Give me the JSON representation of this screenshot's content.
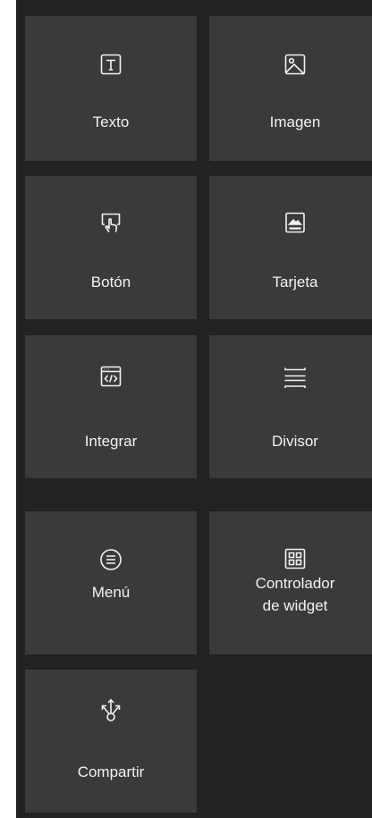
{
  "widgets": [
    {
      "label": "Texto",
      "icon": "text-icon"
    },
    {
      "label": "Imagen",
      "icon": "image-icon"
    },
    {
      "label": "Botón",
      "icon": "button-icon"
    },
    {
      "label": "Tarjeta",
      "icon": "card-icon"
    },
    {
      "label": "Integrar",
      "icon": "embed-icon"
    },
    {
      "label": "Divisor",
      "icon": "divider-icon"
    },
    {
      "label": "Menú",
      "icon": "menu-icon"
    },
    {
      "label": "Controlador\nde widget",
      "icon": "widget-controller-icon"
    },
    {
      "label": "Compartir",
      "icon": "share-icon"
    }
  ]
}
